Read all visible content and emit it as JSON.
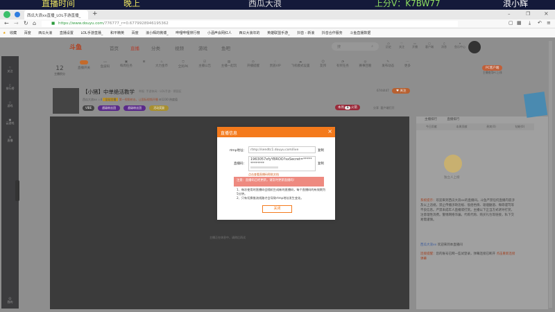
{
  "overlay_banner": {
    "left": "直播时间",
    "mid": "晚上",
    "brand": "西瓜大浪",
    "contact": "上分V：K7BW77",
    "right": "浪小辉"
  },
  "browser": {
    "tab_title": "西瓜大浪xx直播_LOL手游直播_",
    "new_tab": "+",
    "url_host": "https://www.douyu.com",
    "url_path": "/776777_r=0.6779928946195362",
    "bookmarks": [
      "收藏",
      "百度",
      "西瓜大浪",
      "直播设置",
      "LOL手游直播_",
      "和平精英",
      "百度",
      "浪小辉的微博_",
      "哔哩哔哩排行榜",
      "小酒声会网红人",
      "西瓜大浪年的",
      "英雄联盟手游_",
      "抖音 - 新浪",
      "抖音合作服务",
      "斗鱼直播数据"
    ]
  },
  "site": {
    "nav": [
      "首页",
      "直播",
      "分类",
      "视频",
      "游戏",
      "鱼吧"
    ],
    "search_placeholder": "搜",
    "header_icons": [
      "历史",
      "关注",
      "开播",
      "客户端",
      "消息",
      "鱼乐中心"
    ],
    "level": "12",
    "level_label": "主播积分",
    "tools": [
      "直播开关",
      "鱼波码",
      "每周任务",
      "",
      "大力金币",
      "全民PK",
      "主播公告",
      "主播一起玩",
      "开播提醒",
      "",
      "",
      "贵族VIP",
      "飞机模式设置",
      "友邦",
      "有奖任务",
      "赛事回看",
      "发布动态",
      "更多"
    ],
    "pc_client": "PC客户端",
    "pc_sub": "主播使用PC上线",
    "sidebar": [
      "关注",
      "排行榜",
      "游戏",
      "云游戏",
      "直播",
      "",
      "我的"
    ]
  },
  "room": {
    "title": "【小猪】中单绝活教学",
    "tag": "举报",
    "category": "手游休闲 · LOL手游 · 德国区",
    "streamer": "西瓜大浪xx",
    "level": "4",
    "medal": "全站主播",
    "hint": "第一视角射击，让国际视频开播",
    "viewers": "1230 热度值",
    "badges": [
      "VIBE",
      "超级粉丝团",
      "超级粉丝团",
      "活动奖励"
    ],
    "followers": "6744447",
    "follow": "关注",
    "hot_label": "本周",
    "hot_rank": "1",
    "hot_suffix": "火箭",
    "share": "分享",
    "client": "客户端打开",
    "video_hint": "主播正在休息中，请稍后再试"
  },
  "modal": {
    "title": "直播信息",
    "close_x": "×",
    "rtmp_label": "rtmp地址：",
    "rtmp_value": "rtmp://sendtc1.douyu.com/live",
    "key_label": "直播码：",
    "key_value": "1963057xfyYBROO?sxSecret=*************",
    "copy": "复制",
    "link_text": "点击查看直播码帮助文档",
    "warning": "注意：直播码已经更新，请及时更新直播码！",
    "notes": [
      "1、每次使用时直播码会随机生成新的直播码，每个直播码的有效期为5分钟。",
      "2、只有切换推流线路才会导致rtmp地址发生变化。"
    ],
    "close_button": "关闭"
  },
  "right_panel": {
    "rank1": "主播排行",
    "rank2": "直播排行",
    "tabs": [
      "今日贡献",
      "本周贡献",
      "贵宾(0)",
      "钻粉(0)"
    ],
    "avatar_caption": "独立人上榜",
    "system_label": "系统提示：",
    "system_text": "欢迎来到西瓜大浪xx的直播间。斗鱼严禁任何直播内容涉及以上违规，禁止传播涉政违规、低俗色情、吸烟酗酒、侮辱谩骂等不良信息。严禁未成年人直播或打赏。主播以下正当方式诱导打赏，注意理性消费。警惕网络诈骗，代练代购、购买礼包等链接，私下交易需谨慎。",
    "welcome_user": "西瓜大浪xx",
    "welcome_text": "欢迎来到本直播间",
    "conn_label": "连接提醒：",
    "conn_text": "您的账号已网一些试登录，弹幕连接已断开",
    "conn_link": "点击重新连接弹幕"
  }
}
